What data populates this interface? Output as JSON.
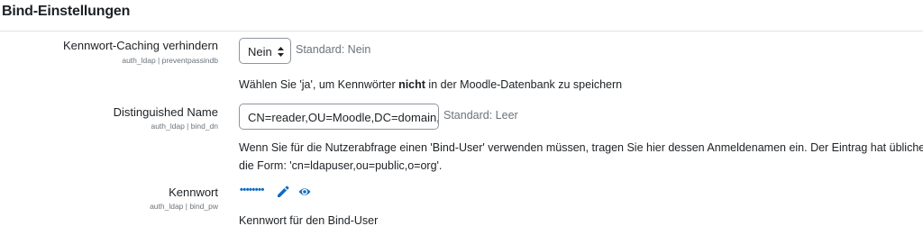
{
  "section": {
    "title": "Bind-Einstellungen"
  },
  "settings": [
    {
      "label": "Kennwort-Caching verhindern",
      "meta": "auth_ldap | preventpassindb",
      "control": "select",
      "value": "Nein",
      "default": "Standard: Nein",
      "description_pre": "Wählen Sie 'ja', um Kennwörter ",
      "description_bold": "nicht",
      "description_post": " in der Moodle-Datenbank zu speichern"
    },
    {
      "label": "Distinguished Name",
      "meta": "auth_ldap | bind_dn",
      "control": "text",
      "value": "CN=reader,OU=Moodle,DC=domain,DC=local",
      "default": "Standard: Leer",
      "description_line1": "Wenn Sie für die Nutzerabfrage einen 'Bind-User' verwenden müssen, tragen Sie hier dessen Anmeldenamen ein. Der Eintrag hat üblicherweise",
      "description_line2": "die Form: 'cn=ldapuser,ou=public,o=org'."
    },
    {
      "label": "Kennwort",
      "meta": "auth_ldap | bind_pw",
      "control": "password",
      "masked_value": "••••••••",
      "description": "Kennwort für den Bind-User"
    }
  ],
  "icons": {
    "select_arrows": "sort-arrows-icon",
    "edit": "pencil-icon",
    "reveal": "eye-icon"
  },
  "colors": {
    "accent": "#0f6cbf",
    "text": "#1d2125",
    "muted": "#6a737b",
    "border": "#8f959e"
  }
}
